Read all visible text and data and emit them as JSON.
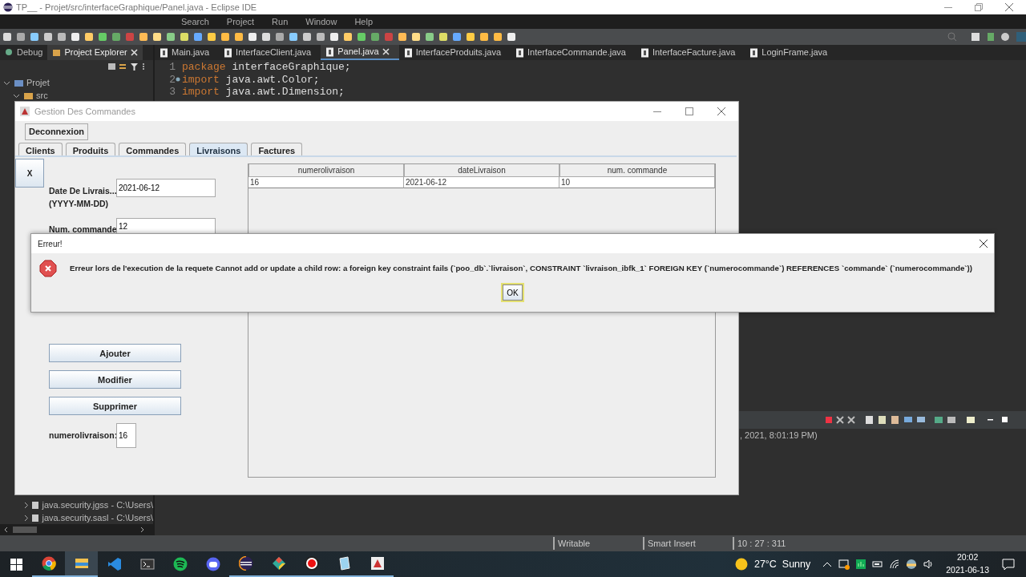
{
  "ide": {
    "title": "TP__ - Projet/src/interfaceGraphique/Panel.java - Eclipse IDE",
    "menu": [
      "Search",
      "Project",
      "Run",
      "Window",
      "Help"
    ],
    "side_tabs": [
      {
        "label": "Debug",
        "selected": false
      },
      {
        "label": "Project Explorer",
        "selected": true
      }
    ],
    "tree": [
      {
        "label": "Projet",
        "expanded": true,
        "children": [
          {
            "label": "src",
            "expanded": true
          }
        ]
      }
    ],
    "tree_bottom": [
      {
        "label": "java.security.jgss - C:\\Users\\",
        "expanded": false
      },
      {
        "label": "java.security.sasl - C:\\Users\\",
        "expanded": false
      }
    ],
    "editor_tabs": [
      {
        "label": "Main.java",
        "selected": false
      },
      {
        "label": "InterfaceClient.java",
        "selected": false
      },
      {
        "label": "Panel.java",
        "selected": true
      },
      {
        "label": "InterfaceProduits.java",
        "selected": false
      },
      {
        "label": "InterfaceCommande.java",
        "selected": false
      },
      {
        "label": "InterfaceFacture.java",
        "selected": false
      },
      {
        "label": "LoginFrame.java",
        "selected": false
      }
    ],
    "code": [
      {
        "number": "1",
        "marker": false,
        "keyword": "package",
        "rest": " interfaceGraphique;"
      },
      {
        "number": "2",
        "marker": true,
        "keyword": "import",
        "rest": " java.awt.Color;"
      },
      {
        "number": "3",
        "marker": false,
        "keyword": "import",
        "rest": " java.awt.Dimension;"
      }
    ],
    "console_text": ", 2021, 8:01:19 PM)",
    "status": [
      "Writable",
      "Smart Insert",
      "10 : 27 : 311"
    ]
  },
  "app": {
    "title": "Gestion Des Commandes",
    "logout": "Deconnexion",
    "tabs": [
      {
        "label": "Clients",
        "selected": false
      },
      {
        "label": "Produits",
        "selected": false
      },
      {
        "label": "Commandes",
        "selected": false
      },
      {
        "label": "Livraisons",
        "selected": true
      },
      {
        "label": "Factures",
        "selected": false
      }
    ],
    "close_label": "X",
    "date_label": "Date De Livrais...",
    "date_hint": "(YYYY-MM-DD)",
    "date_value": "2021-06-12",
    "order_label": "Num. commande",
    "order_value": "12",
    "buttons": [
      "Ajouter",
      "Modifier",
      "Supprimer"
    ],
    "id_label": "numerolivraison:",
    "id_value": "16",
    "table": {
      "columns": [
        "numerolivraison",
        "dateLivraison",
        "num. commande"
      ],
      "rows": [
        [
          "16",
          "2021-06-12",
          "10"
        ]
      ]
    }
  },
  "dialog": {
    "title": "Erreur!",
    "message": "Erreur lors de l'execution de la requete Cannot add or update a child row: a foreign key constraint fails (`poo_db`.`livraison`, CONSTRAINT `livraison_ibfk_1` FOREIGN KEY (`numerocommande`) REFERENCES `commande` (`numerocommande`))",
    "button": "OK"
  },
  "taskbar": {
    "apps": [
      {
        "kind": "browser",
        "open": true,
        "selected": false
      },
      {
        "kind": "folder",
        "open": true,
        "selected": true
      },
      {
        "kind": "code",
        "open": false,
        "selected": false
      },
      {
        "kind": "terminal",
        "open": false,
        "selected": false
      },
      {
        "kind": "music",
        "open": false,
        "selected": false
      },
      {
        "kind": "chat",
        "open": false,
        "selected": false
      },
      {
        "kind": "ide",
        "open": true,
        "selected": false
      },
      {
        "kind": "git",
        "open": true,
        "selected": false
      },
      {
        "kind": "record",
        "open": true,
        "selected": false
      },
      {
        "kind": "notes",
        "open": true,
        "selected": false
      },
      {
        "kind": "java",
        "open": true,
        "selected": false
      }
    ],
    "weather": "27°C  Sunny",
    "time": "20:02",
    "date": "2021-06-13"
  }
}
